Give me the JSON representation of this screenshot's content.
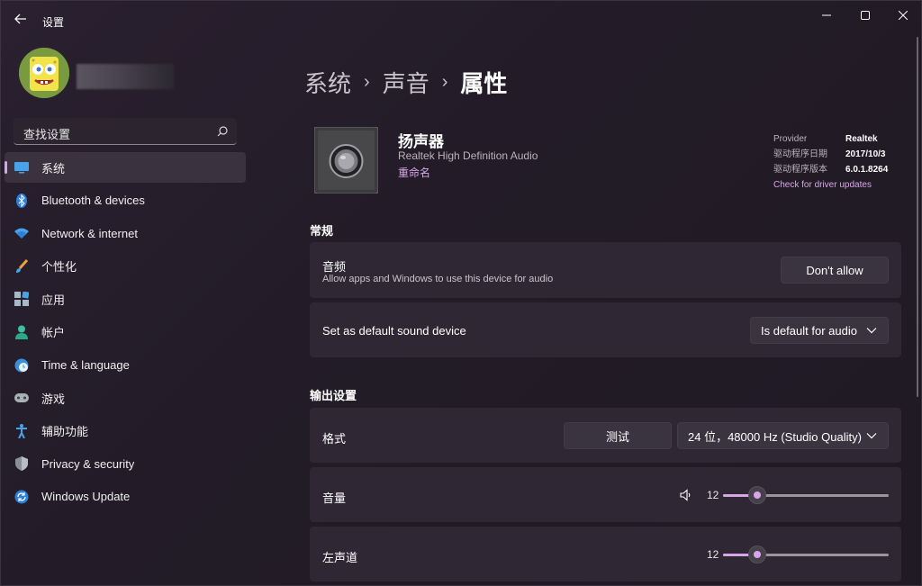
{
  "window": {
    "title": "设置",
    "controls": [
      "minimize",
      "maximize",
      "close"
    ]
  },
  "sidebar": {
    "search_placeholder": "查找设置",
    "items": [
      {
        "label": "系统",
        "icon": "system-icon",
        "active": true
      },
      {
        "label": "Bluetooth & devices",
        "icon": "bluetooth-icon"
      },
      {
        "label": "Network & internet",
        "icon": "network-icon"
      },
      {
        "label": "个性化",
        "icon": "personalization-icon"
      },
      {
        "label": "应用",
        "icon": "apps-icon"
      },
      {
        "label": "帐户",
        "icon": "account-icon"
      },
      {
        "label": "Time & language",
        "icon": "time-language-icon"
      },
      {
        "label": "游戏",
        "icon": "gaming-icon"
      },
      {
        "label": "辅助功能",
        "icon": "accessibility-icon"
      },
      {
        "label": "Privacy & security",
        "icon": "privacy-icon"
      },
      {
        "label": "Windows Update",
        "icon": "windows-update-icon"
      }
    ]
  },
  "breadcrumb": {
    "items": [
      "系统",
      "声音"
    ],
    "current": "属性"
  },
  "device": {
    "name": "扬声器",
    "description": "Realtek High Definition Audio",
    "rename_link": "重命名",
    "driver": {
      "provider_label": "Provider",
      "provider_value": "Realtek",
      "date_label": "驱动程序日期",
      "date_value": "2017/10/3",
      "version_label": "驱动程序版本",
      "version_value": "6.0.1.8264",
      "update_link": "Check for driver updates"
    }
  },
  "general": {
    "section_title": "常规",
    "audio": {
      "title": "音频",
      "subtitle": "Allow apps and Windows to use this device for audio",
      "button": "Don't allow"
    },
    "default_device": {
      "title": "Set as default sound device",
      "value": "Is default for audio"
    }
  },
  "output": {
    "section_title": "输出设置",
    "format": {
      "title": "格式",
      "test_button": "测试",
      "value": "24 位，48000 Hz (Studio Quality)"
    },
    "volume": {
      "title": "音量",
      "value": "12",
      "level": 0.12
    },
    "left_channel": {
      "title": "左声道",
      "value": "12",
      "level": 0.12
    }
  },
  "colors": {
    "accent": "#d8a6e8",
    "background": "#231c28",
    "card": "#2f2734"
  }
}
